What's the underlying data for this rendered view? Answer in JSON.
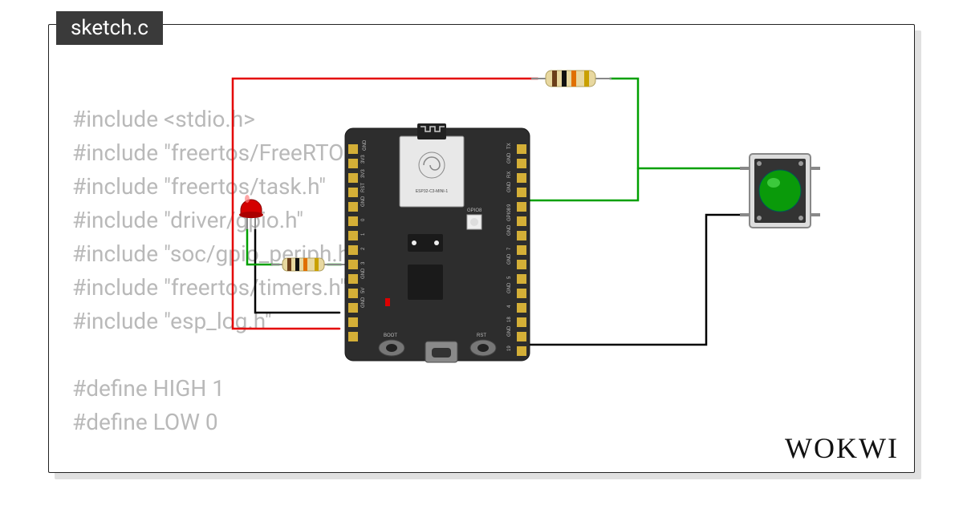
{
  "tab": {
    "label": "sketch.c"
  },
  "code": {
    "lines": [
      "#include <stdio.h>",
      "#include \"freertos/FreeRTOS.h\"",
      "#include \"freertos/task.h\"",
      "#include \"driver/gpio.h\"",
      "#include \"soc/gpio_periph.h\"",
      "#include \"freertos/timers.h\"",
      "#include \"esp_log.h\"",
      "",
      "#define HIGH 1",
      "#define LOW 0"
    ]
  },
  "brand": "WOKWI",
  "board": {
    "name": "ESP32-C3-MINI-1",
    "left_pins": [
      "GND",
      "3V3",
      "3V3",
      "RST",
      "GND",
      "0",
      "1",
      "2",
      "3",
      "GND",
      "5V",
      "GND"
    ],
    "right_pins": [
      "TX",
      "GND",
      "RX",
      "GND",
      "9",
      "GPI08",
      "GND",
      "7",
      "GND",
      "5",
      "GND",
      "4",
      "18",
      "GND",
      "19",
      "GND"
    ],
    "buttons": {
      "boot": "BOOT",
      "rst": "RST"
    },
    "neo_label": "GPIO8"
  },
  "components": {
    "led": {
      "color": "red"
    },
    "resistor1": {
      "bands": [
        "brown",
        "black",
        "orange",
        "gold"
      ]
    },
    "resistor2": {
      "bands": [
        "brown",
        "black",
        "orange",
        "gold"
      ]
    },
    "pushbutton": {
      "color": "green"
    }
  }
}
